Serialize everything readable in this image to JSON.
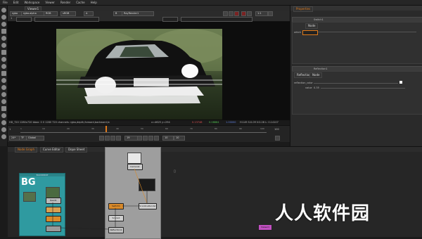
{
  "menu": [
    "File",
    "Edit",
    "Workspace",
    "Viewer",
    "Render",
    "Cache",
    "Help"
  ],
  "viewer": {
    "tab_label": "Viewer1",
    "channels": "rgba",
    "channel_alpha": "rgba.alpha",
    "colorspace": "RGB",
    "gamut": "sRGB",
    "input_a": "A",
    "input_b": "B",
    "input_b_node": "RayRender1",
    "zoom": "1:1",
    "frame": "1"
  },
  "info": {
    "format": "HD_720 1280x720  bbox: 0 0 1280 720  channels: rgba,depth,forward,backward,tc",
    "coords": "x=4625 y=294",
    "r": "0.13748",
    "g": "0.08864",
    "b": "1.00000",
    "hsvl": "H:149 S:0.09 V:0.28  L: 0.14107"
  },
  "timeline": {
    "start": "1",
    "end": "100",
    "labels": [
      "1",
      "10",
      "20",
      "30",
      "40",
      "50",
      "60",
      "70",
      "80",
      "90",
      "100"
    ],
    "fps": "24*",
    "tf": "TF",
    "global": "Global",
    "current_frame": "19",
    "step": "10",
    "step2": "10"
  },
  "properties": {
    "title": "Properties",
    "panel1_name": "Switch1",
    "panel1_tab": "Node",
    "which_label": "which",
    "panel2_name": "Reflection1",
    "panel2_tab1": "Reflection",
    "panel2_tab2": "Node",
    "reflection_color_label": "reflection_color",
    "value_label": "value",
    "value": "0.35"
  },
  "nodegraph": {
    "tabs": [
      "Node Graph",
      "Curve Editor",
      "Dope Sheet"
    ],
    "backdrop_label": "BG",
    "backdrop_header": "BACKDROP",
    "readgeo_label": "ReadGeo1",
    "read_label": "Read1",
    "switch_label": "Switch1",
    "scene_label": "Scene1",
    "render_label": "ScanlineRender",
    "viewer_label": "Viewer1",
    "camera_label": "Camera1",
    "reflection_label": "Reflection1"
  },
  "colors": {
    "accent": "#e07a1a",
    "backdrop": "#2f9aa0",
    "node_orange": "#d98a2a",
    "node_grey": "#9a9a9a"
  },
  "watermark": "人人软件园"
}
